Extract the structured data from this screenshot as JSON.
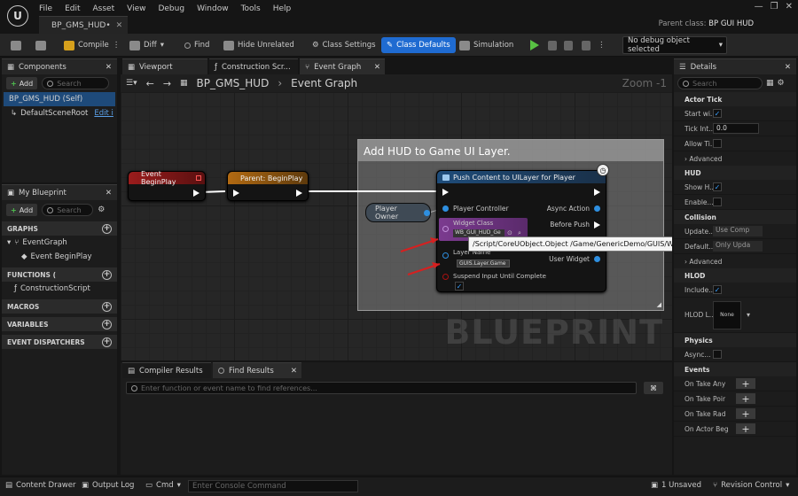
{
  "menu": [
    "File",
    "Edit",
    "Asset",
    "View",
    "Debug",
    "Window",
    "Tools",
    "Help"
  ],
  "document_tab": "BP_GMS_HUD•",
  "parent_class": {
    "label": "Parent class:",
    "value": "BP GUI HUD"
  },
  "toolbar": {
    "compile": "Compile",
    "diff": "Diff",
    "find": "Find",
    "hide_unrelated": "Hide Unrelated",
    "class_settings": "Class Settings",
    "class_defaults": "Class Defaults",
    "simulation": "Simulation",
    "debug_object": "No debug object selected"
  },
  "components": {
    "tab": "Components",
    "add": "Add",
    "search_placeholder": "Search",
    "self_item": "BP_GMS_HUD (Self)",
    "root_item": "DefaultSceneRoot",
    "edit_link": "Edit i"
  },
  "my_blueprint": {
    "tab": "My Blueprint",
    "add": "Add",
    "search_placeholder": "Search",
    "graphs": "GRAPHS",
    "event_graph": "EventGraph",
    "event_begin_play": "Event BeginPlay",
    "functions": "FUNCTIONS (",
    "construction_script": "ConstructionScript",
    "macros": "MACROS",
    "variables": "VARIABLES",
    "dispatchers": "EVENT DISPATCHERS"
  },
  "editor_tabs": {
    "viewport": "Viewport",
    "construction": "Construction Scr...",
    "event_graph": "Event Graph"
  },
  "breadcrumb": {
    "root": "BP_GMS_HUD",
    "sep": "›",
    "leaf": "Event Graph",
    "zoom": "Zoom -1"
  },
  "graph": {
    "comment": "Add HUD to Game UI Layer.",
    "event_node": "Event BeginPlay",
    "parent_node": "Parent: BeginPlay",
    "player_owner": "Player Owner",
    "push_node": {
      "title": "Push Content to UILayer for Player",
      "player_controller": "Player Controller",
      "async_action": "Async Action",
      "before_push": "Before Push",
      "after_push": "After Push",
      "user_widget": "User Widget",
      "widget_class": "Widget Class",
      "widget_value": "WB_GUI_HUD_Ge",
      "layer_name": "Layer Name",
      "layer_value": "GUIS.Layer.Game",
      "suspend_input": "Suspend Input Until Complete"
    },
    "tooltip": "/Script/CoreUObject.Object /Game/GenericDemo/GUIS/WB_GUI_HUD_Generic.WB_GUI_HUD_Generic_C",
    "watermark": "BLUEPRINT"
  },
  "bottom": {
    "compiler_tab": "Compiler Results",
    "find_tab": "Find Results",
    "find_placeholder": "Enter function or event name to find references..."
  },
  "details": {
    "tab": "Details",
    "search_placeholder": "Search",
    "actor_tick": "Actor Tick",
    "start_with": "Start wi...",
    "tick_interval": "Tick Int...",
    "tick_value": "0.0",
    "allow_tick": "Allow Ti...",
    "advanced": "Advanced",
    "hud": "HUD",
    "show_hud": "Show H...",
    "enable": "Enable...",
    "collision": "Collision",
    "update": "Update...",
    "update_value": "Use Comp",
    "default": "Default...",
    "default_value": "Only Upda",
    "hlod": "HLOD",
    "include": "Include...",
    "hlod_layer": "HLOD L...",
    "none": "None",
    "physics": "Physics",
    "async": "Async...",
    "events": "Events",
    "on_take_any": "On Take Any",
    "on_take_point": "On Take Poir",
    "on_take_radial": "On Take Rad",
    "on_actor_begin": "On Actor Beg"
  },
  "status": {
    "content_drawer": "Content Drawer",
    "output_log": "Output Log",
    "cmd": "Cmd",
    "console_placeholder": "Enter Console Command",
    "unsaved": "1 Unsaved",
    "revision": "Revision Control"
  },
  "colors": {
    "accent": "#1f6bd1",
    "event_red": "#9b1c1c",
    "func_orange": "#b26a12",
    "push_blue": "#1e4c7a",
    "widget_purple": "#7b3b8f"
  }
}
